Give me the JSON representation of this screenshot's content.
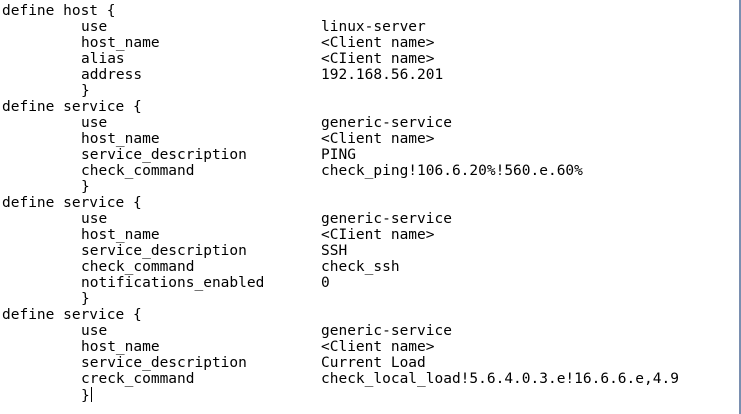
{
  "blocks": [
    {
      "header": "define host {",
      "entries": [
        {
          "key": "use",
          "value": "linux-server"
        },
        {
          "key": "host_name",
          "value": "<Client name>"
        },
        {
          "key": "alias",
          "value": "<CIient name>"
        },
        {
          "key": "address",
          "value": "192.168.56.201"
        }
      ],
      "close": "}"
    },
    {
      "header": "define service {",
      "entries": [
        {
          "key": "use",
          "value": "generic-service"
        },
        {
          "key": "host_name",
          "value": "<Client name>"
        },
        {
          "key": "service_description",
          "value": "PING"
        },
        {
          "key": "check_command",
          "value": "check_ping!106.6.20%!560.e.60%"
        }
      ],
      "close": "}"
    },
    {
      "header": "define service {",
      "entries": [
        {
          "key": "use",
          "value": "generic-service"
        },
        {
          "key": "host_name",
          "value": "<CIient name>"
        },
        {
          "key": "service_description",
          "value": "SSH"
        },
        {
          "key": "check_command",
          "value": "check_ssh"
        },
        {
          "key": "notifications_enabled",
          "value": "0"
        }
      ],
      "close": "}"
    },
    {
      "header": "define service {",
      "entries": [
        {
          "key": "use",
          "value": "generic-service"
        },
        {
          "key": "host_name",
          "value": "<Client name>"
        },
        {
          "key": "service_description",
          "value": "Current Load"
        },
        {
          "key": "creck_command",
          "value": "check_local_load!5.6.4.0.3.e!16.6.6.e,4.9"
        }
      ],
      "close": "}"
    }
  ]
}
